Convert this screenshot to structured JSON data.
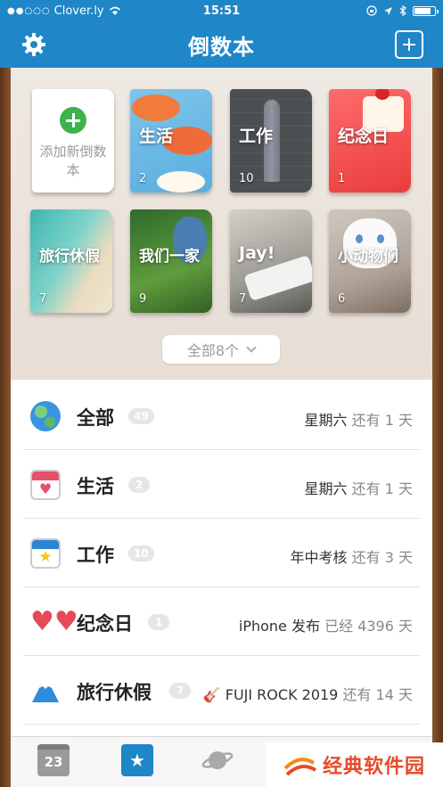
{
  "status_bar": {
    "carrier": "Clover.ly",
    "time": "15:51"
  },
  "nav": {
    "title": "倒数本"
  },
  "books": [
    {
      "label": "添加新倒数本"
    },
    {
      "label": "生活",
      "count": "2"
    },
    {
      "label": "工作",
      "count": "10"
    },
    {
      "label": "纪念日",
      "count": "1"
    },
    {
      "label": "旅行休假",
      "count": "7"
    },
    {
      "label": "我们一家",
      "count": "9"
    },
    {
      "label": "Jay!",
      "count": "7"
    },
    {
      "label": "小动物们",
      "count": "6"
    }
  ],
  "more_button": {
    "label": "全部8个"
  },
  "list": [
    {
      "title": "全部",
      "badge": "49",
      "right_main": "星期六",
      "right_muted": "还有 1 天",
      "icon": "globe-icon"
    },
    {
      "title": "生活",
      "badge": "2",
      "right_main": "星期六",
      "right_muted": "还有 1 天",
      "icon": "heart-calendar-icon"
    },
    {
      "title": "工作",
      "badge": "10",
      "right_main": "年中考核",
      "right_muted": "还有 3 天",
      "icon": "star-calendar-icon"
    },
    {
      "title": "纪念日",
      "badge": "1",
      "right_main": "iPhone 发布",
      "right_muted": "已经 4396 天",
      "icon": "hearts-icon"
    },
    {
      "title": "旅行休假",
      "badge": "7",
      "right_main": "🎸 FUJI ROCK 2019",
      "right_muted": "还有 14 天",
      "icon": "mount-fuji-icon"
    }
  ],
  "tabbar": {
    "calendar_day": "23"
  },
  "watermark": {
    "text": "经典软件园"
  },
  "colors": {
    "primary": "#1f86c8",
    "badge": "#e6e6e6",
    "add_green": "#3db24a"
  }
}
